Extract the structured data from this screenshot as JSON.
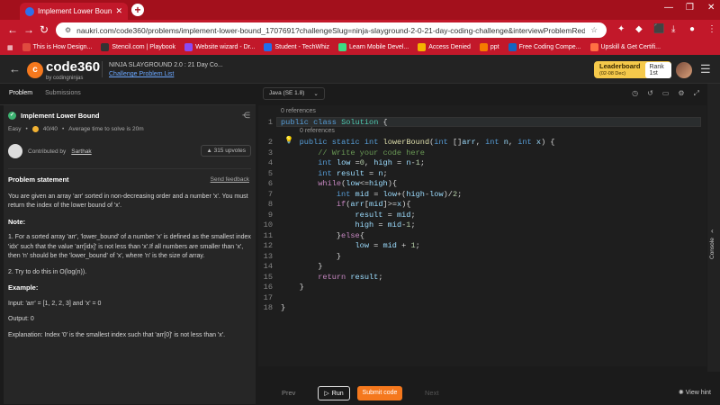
{
  "browser": {
    "tab_title": "Implement Lower Bound - Na",
    "url": "naukri.com/code360/problems/implement-lower-bound_1707691?challengeSlug=ninja-slayground-2-0-21-day-coding-challenge&interviewProblemRedirection=true",
    "bookmarks": [
      "This is How Design...",
      "Stencil.com | Playbook",
      "Website wizard - Dr...",
      "Student - TechWhiz",
      "Learn Mobile Devel...",
      "Access Denied",
      "ppt",
      "Free Coding Compe...",
      "Upskill & Get Certifi..."
    ]
  },
  "header": {
    "brand": "code360",
    "brand_sub": "by codingninjas",
    "contest_title": "NINJA SLAYGROUND 2.0 : 21 Day Co...",
    "contest_link": "Challenge Problem List",
    "leaderboard_label": "Leaderboard",
    "leaderboard_date": "(02-08 Dec)",
    "rank": "Rank 1st"
  },
  "problem": {
    "tabs": [
      "Problem",
      "Submissions"
    ],
    "title": "Implement Lower Bound",
    "difficulty": "Easy",
    "points": "40/40",
    "avg_time": "Average time to solve is 20m",
    "contributed_label": "Contributed by",
    "contributor": "Sarthak",
    "upvotes": "315 upvotes",
    "statement_heading": "Problem statement",
    "feedback_link": "Send feedback",
    "statement": "You are given an array 'arr' sorted in non-decreasing order and a number 'x'. You must return the index of the lower bound of 'x'.",
    "note_heading": "Note:",
    "note_1": "1. For a sorted array 'arr', 'lower_bound' of a number 'x' is defined as the smallest index 'idx' such that the value 'arr[idx]' is not less than 'x'.If all numbers are smaller than 'x', then 'n' should be the 'lower_bound' of 'x', where 'n' is the size of array.",
    "note_2": "2. Try to do this in O(log(n)).",
    "example_heading": "Example:",
    "example_input": "Input: 'arr' = [1, 2, 2, 3] and 'x' = 0",
    "example_output": "Output: 0",
    "example_explanation": "Explanation: Index '0' is the smallest index such that 'arr[0]' is not less than 'x'."
  },
  "editor": {
    "language": "Java (SE 1.8)",
    "refs_1": "0 references",
    "refs_2": "0 references",
    "line_numbers": [
      "1",
      "2",
      "3",
      "4",
      "5",
      "6",
      "7",
      "8",
      "9",
      "10",
      "11",
      "12",
      "13",
      "14",
      "15",
      "16",
      "17",
      "18"
    ]
  },
  "bottom": {
    "prev": "Prev",
    "run": "Run",
    "submit": "Submit code",
    "next": "Next",
    "hint": "View hint",
    "console": "Console"
  },
  "colors": {
    "accent": "#f5781d",
    "browser_red": "#c2182a",
    "leaderboard": "#f5c94b"
  }
}
